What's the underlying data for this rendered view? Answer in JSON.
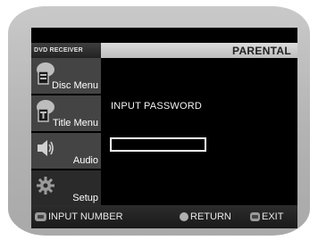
{
  "header": {
    "device_label": "DVD RECEIVER",
    "section_title": "PARENTAL"
  },
  "sidebar": {
    "items": [
      {
        "label": "Disc Menu",
        "icon": "disc-menu-icon"
      },
      {
        "label": "Title Menu",
        "icon": "title-menu-icon"
      },
      {
        "label": "Audio",
        "icon": "speaker-icon"
      },
      {
        "label": "Setup",
        "icon": "gear-icon",
        "selected": true
      }
    ]
  },
  "main": {
    "prompt": "INPUT PASSWORD",
    "password_value": ""
  },
  "footer": {
    "input_hint": "INPUT NUMBER",
    "return_hint": "RETURN",
    "exit_hint": "EXIT"
  },
  "colors": {
    "frame": "#b8b8b8",
    "screen_bg": "#000000",
    "header_bar": "#cfcfcf",
    "menu_item_bg": "#444444",
    "text": "#ffffff"
  }
}
